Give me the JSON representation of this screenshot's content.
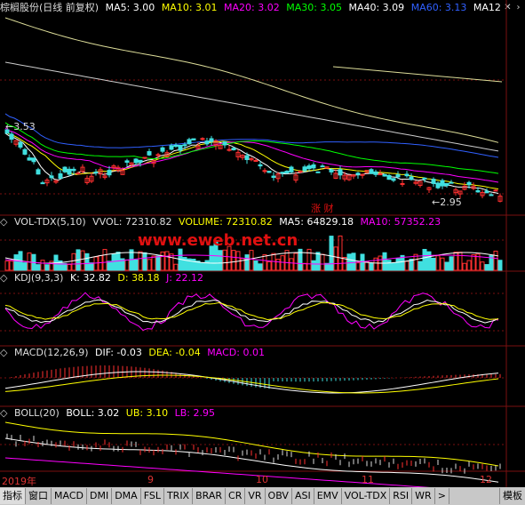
{
  "main": {
    "title": "棕榈股份(日线 前复权)",
    "ma": [
      {
        "label": "MA5: 3.00",
        "color": "#ffffff"
      },
      {
        "label": "MA10: 3.01",
        "color": "#ffff00"
      },
      {
        "label": "MA20: 3.02",
        "color": "#ff00ff"
      },
      {
        "label": "MA30: 3.05",
        "color": "#00ff00"
      },
      {
        "label": "MA40: 3.09",
        "color": "#ffffff"
      },
      {
        "label": "MA60: 3.13",
        "color": "#3060ff"
      },
      {
        "label": "MA12",
        "color": "#ffffff"
      }
    ],
    "high_label": "3.53",
    "low_label": "2.95",
    "annotation": "涨  财"
  },
  "vol": {
    "title": "VOL-TDX(5,10)",
    "vvol": "VVOL: 72310.82",
    "volume": "VOLUME: 72310.82",
    "ma5": "MA5: 64829.18",
    "ma10": "MA10: 57352.23"
  },
  "kdj": {
    "title": "KDJ(9,3,3)",
    "k": "K: 32.82",
    "d": "D: 38.18",
    "j": "J: 22.12"
  },
  "macd": {
    "title": "MACD(12,26,9)",
    "dif": "DIF: -0.03",
    "dea": "DEA: -0.04",
    "macd": "MACD: 0.01"
  },
  "boll": {
    "title": "BOLL(20)",
    "boll": "BOLL: 3.02",
    "ub": "UB: 3.10",
    "lb": "LB: 2.95"
  },
  "watermark": "www.eweb.net.cn",
  "date_axis": [
    "2019年",
    "9",
    "10",
    "11",
    "12"
  ],
  "toolbar": {
    "tabs": [
      "指标",
      "窗口",
      "MACD",
      "DMI",
      "DMA",
      "FSL",
      "TRIX",
      "BRAR",
      "CR",
      "VR",
      "OBV",
      "ASI",
      "EMV",
      "VOL-TDX",
      "RSI",
      "WR",
      ">"
    ],
    "template": "模板"
  },
  "colors": {
    "up": "#ff3030",
    "down": "#40e0e0",
    "grid": "#7a1010"
  }
}
